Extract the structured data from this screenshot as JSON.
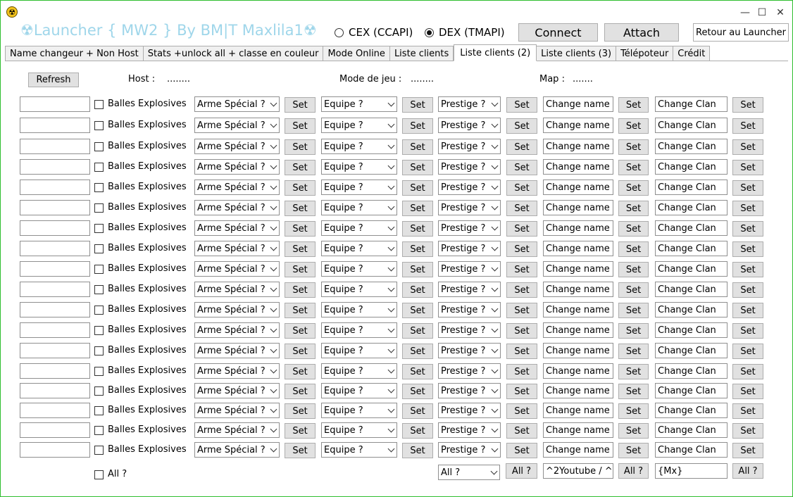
{
  "window": {
    "title": "☢Launcher { MW2 }  By BM|T Maxlila1☢",
    "icon": "radiation-icon",
    "controls": {
      "minimize": "—",
      "maximize": "☐",
      "close": "✕"
    }
  },
  "connection": {
    "options": [
      {
        "label": "CEX (CCAPI)",
        "selected": false
      },
      {
        "label": "DEX (TMAPI)",
        "selected": true
      }
    ],
    "connect_label": "Connect",
    "attach_label": "Attach",
    "back_label": "Retour au Launcher"
  },
  "tabs": [
    {
      "label": "Name changeur + Non Host",
      "active": false
    },
    {
      "label": "Stats +unlock all + classe en couleur",
      "active": false
    },
    {
      "label": "Mode Online",
      "active": false
    },
    {
      "label": "Liste clients",
      "active": false
    },
    {
      "label": "Liste clients (2)",
      "active": true
    },
    {
      "label": "Liste clients (3)",
      "active": false
    },
    {
      "label": "Télépoteur",
      "active": false
    },
    {
      "label": "Crédit",
      "active": false
    }
  ],
  "info": {
    "refresh_label": "Refresh",
    "host_label": "Host :",
    "host_value": "........",
    "mode_label": "Mode de jeu :",
    "mode_value": "........",
    "map_label": "Map :",
    "map_value": "......."
  },
  "row_template": {
    "client_name": "",
    "explosive_label": "Balles Explosives",
    "explosive_checked": false,
    "weapon_select": "Arme Spécial ?",
    "set_label": "Set",
    "equip_select": "Equipe ?",
    "prestige_select": "Prestige ?",
    "change_name_value": "Change name",
    "change_clan_value": "Change Clan"
  },
  "row_count": 18,
  "footer": {
    "all_check_label": "All ?",
    "all_prestige_select": "All ?",
    "all_prestige_button": "All ?",
    "all_name_value": "^2Youtube / ^",
    "all_name_button": "All ?",
    "all_clan_value": "{Mx}",
    "all_clan_button": "All ?"
  },
  "colors": {
    "window_border": "#2fbf2f",
    "title_text": "#9fd6ea",
    "button_face": "#e1e1e1"
  }
}
